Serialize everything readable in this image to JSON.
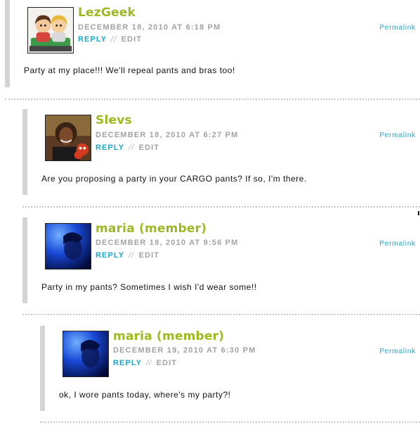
{
  "comments": [
    {
      "author": "LezGeek",
      "date": "DECEMBER 18, 2010 AT 6:18 PM",
      "reply_label": "REPLY",
      "separator": "//",
      "edit_label": "EDIT",
      "permalink_label": "Permalink",
      "text": "Party at my place!!! We'll repeal pants and bras too!",
      "avatar_icon": "cartoon-couple-avatar"
    },
    {
      "author": "Slevs",
      "date": "DECEMBER 18, 2010 AT 6:27 PM",
      "reply_label": "REPLY",
      "separator": "//",
      "edit_label": "EDIT",
      "permalink_label": "Permalink",
      "text": "Are you proposing a party in your CARGO pants? If so, I'm there.",
      "avatar_icon": "photo-avatar"
    },
    {
      "author": "maria (member)",
      "date": "DECEMBER 18, 2010 AT 9:56 PM",
      "reply_label": "REPLY",
      "separator": "//",
      "edit_label": "EDIT",
      "permalink_label": "Permalink",
      "text": "Party in my pants? Sometimes I wish I'd wear some!!",
      "avatar_icon": "blue-photo-avatar"
    },
    {
      "author": "maria (member)",
      "date": "DECEMBER 19, 2010 AT 6:30 PM",
      "reply_label": "REPLY",
      "separator": "//",
      "edit_label": "EDIT",
      "permalink_label": "Permalink",
      "text": "ok, I wore pants today, where's my party?!",
      "avatar_icon": "blue-photo-avatar"
    }
  ],
  "colors": {
    "author": "#a0b820",
    "link": "#1aa8c8",
    "meta": "#a2a2a2",
    "bar": "#d4d4d4"
  }
}
